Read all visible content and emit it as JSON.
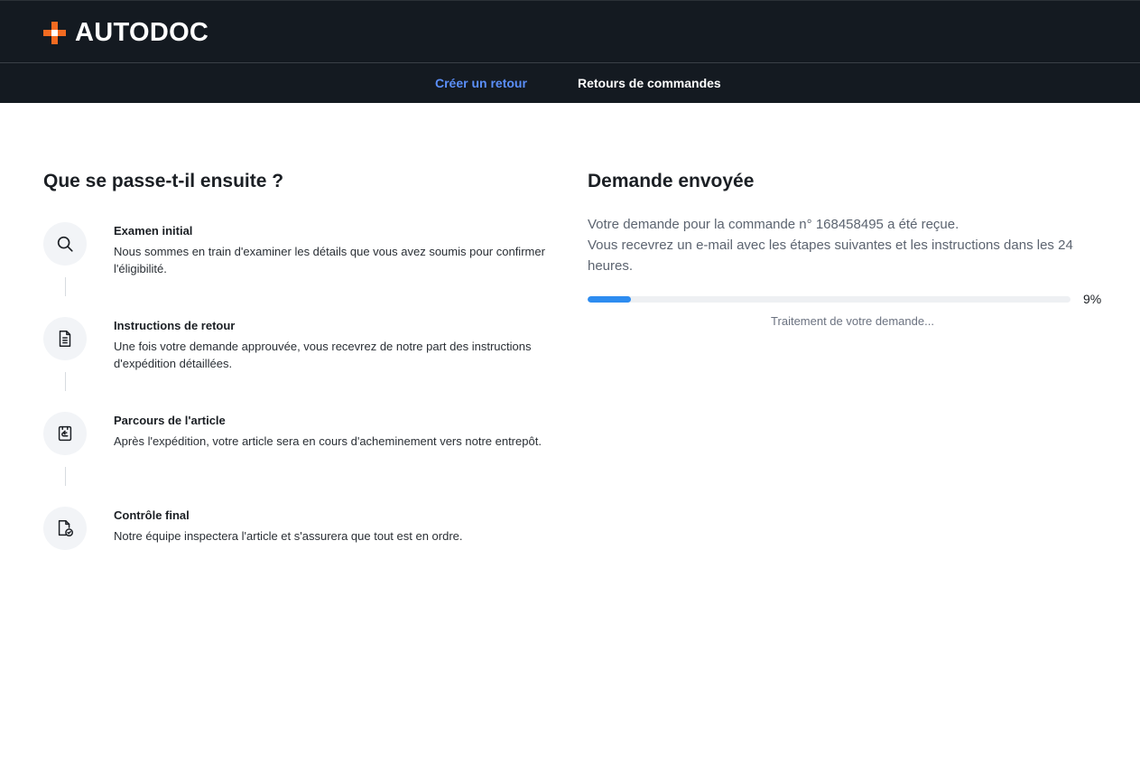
{
  "header": {
    "brand": "AUTODOC",
    "brand_accent_color": "#f36b21",
    "logo_icon": "plus-icon",
    "nav": [
      {
        "label": "Créer un retour",
        "active": true
      },
      {
        "label": "Retours de commandes",
        "active": false
      }
    ]
  },
  "left": {
    "title": "Que se passe-t-il ensuite ?",
    "steps": [
      {
        "icon": "search-icon",
        "title": "Examen initial",
        "desc": "Nous sommes en train d'examiner les détails que vous avez soumis pour confirmer l'éligibilité."
      },
      {
        "icon": "document-icon",
        "title": "Instructions de retour",
        "desc": "Une fois votre demande approuvée, vous recevrez de notre part des instructions d'expédition détaillées."
      },
      {
        "icon": "package-return-icon",
        "title": "Parcours de l'article",
        "desc": "Après l'expédition, votre article sera en cours d'acheminement vers notre entrepôt."
      },
      {
        "icon": "document-check-icon",
        "title": "Contrôle final",
        "desc": "Notre équipe inspectera l'article et s'assurera que tout est en ordre."
      }
    ]
  },
  "right": {
    "title": "Demande envoyée",
    "message_line1": "Votre demande pour la commande n° 168458495 a été reçue.",
    "message_line2": "Vous recevrez un e-mail avec les étapes suivantes et les instructions dans les 24 heures.",
    "progress_percent": 9,
    "progress_label": "9%",
    "progress_color": "#2d8cf0",
    "status": "Traitement de votre demande..."
  }
}
